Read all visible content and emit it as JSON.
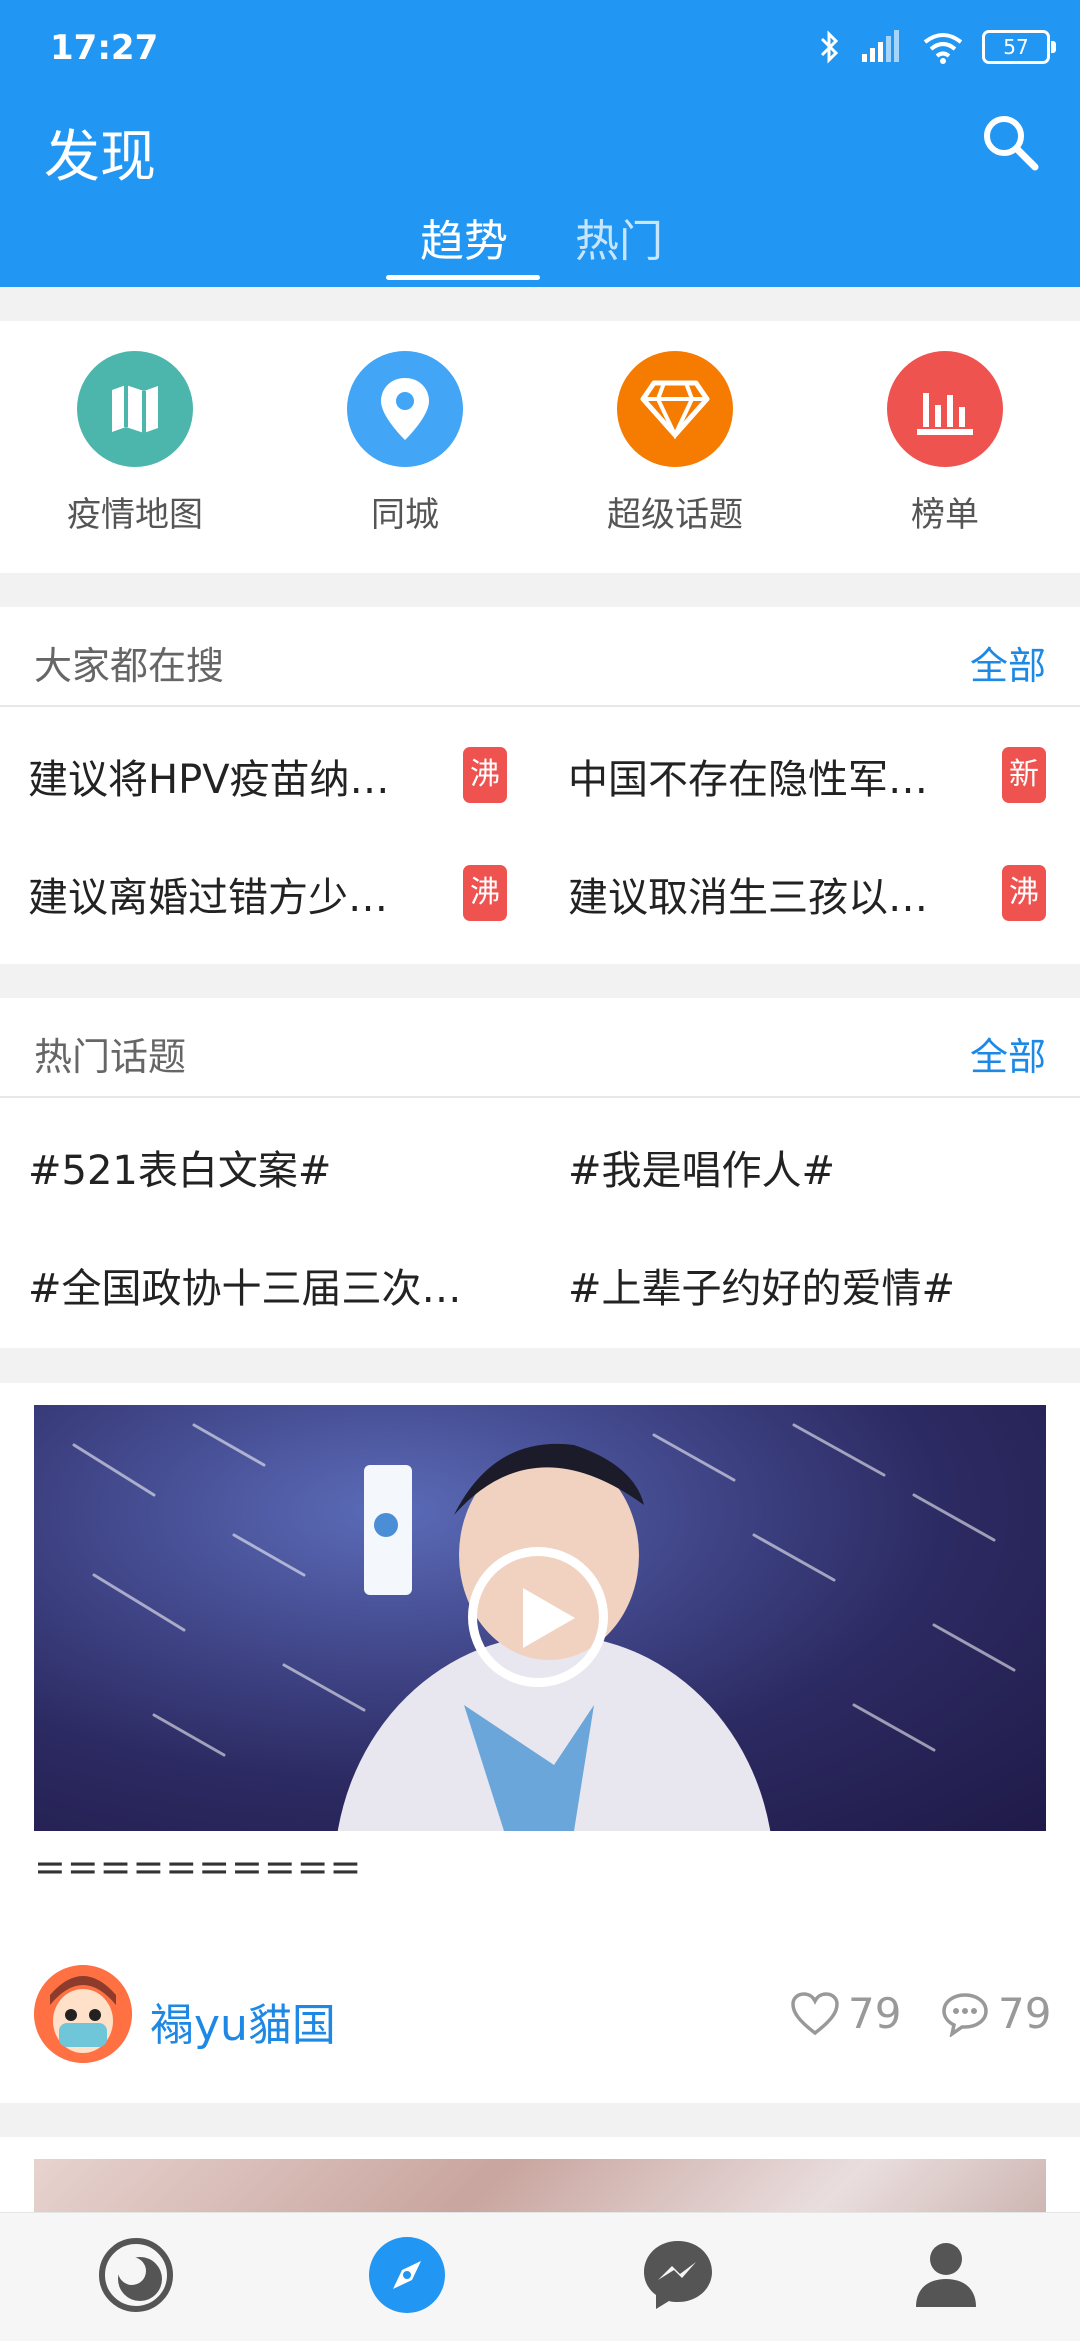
{
  "status_bar": {
    "time": "17:27",
    "battery": "57"
  },
  "header": {
    "title": "发现"
  },
  "tabs": [
    {
      "label": "趋势",
      "active": true
    },
    {
      "label": "热门",
      "active": false
    }
  ],
  "quick_links": [
    {
      "label": "疫情地图",
      "icon": "map-icon",
      "color": "#4db6ac"
    },
    {
      "label": "同城",
      "icon": "location-pin-icon",
      "color": "#42a5f5"
    },
    {
      "label": "超级话题",
      "icon": "diamond-icon",
      "color": "#f57c00"
    },
    {
      "label": "榜单",
      "icon": "bar-chart-icon",
      "color": "#ef5350"
    }
  ],
  "search_section": {
    "title": "大家都在搜",
    "all": "全部",
    "items": [
      {
        "text": "建议将HPV疫苗纳…",
        "badge": "沸"
      },
      {
        "text": "中国不存在隐性军…",
        "badge": "新"
      },
      {
        "text": "建议离婚过错方少…",
        "badge": "沸"
      },
      {
        "text": "建议取消生三孩以…",
        "badge": "沸"
      }
    ]
  },
  "topics_section": {
    "title": "热门话题",
    "all": "全部",
    "items": [
      {
        "text": "#521表白文案#"
      },
      {
        "text": "#我是唱作人#"
      },
      {
        "text": "#全国政协十三届三次…"
      },
      {
        "text": "#上辈子约好的爱情#"
      }
    ]
  },
  "feed": {
    "post_text": "==========",
    "username": "褟yu貓国",
    "likes": "79",
    "comments": "79"
  },
  "colors": {
    "primary": "#2196f3",
    "badge": "#ef5350",
    "link": "#1e88e5"
  }
}
